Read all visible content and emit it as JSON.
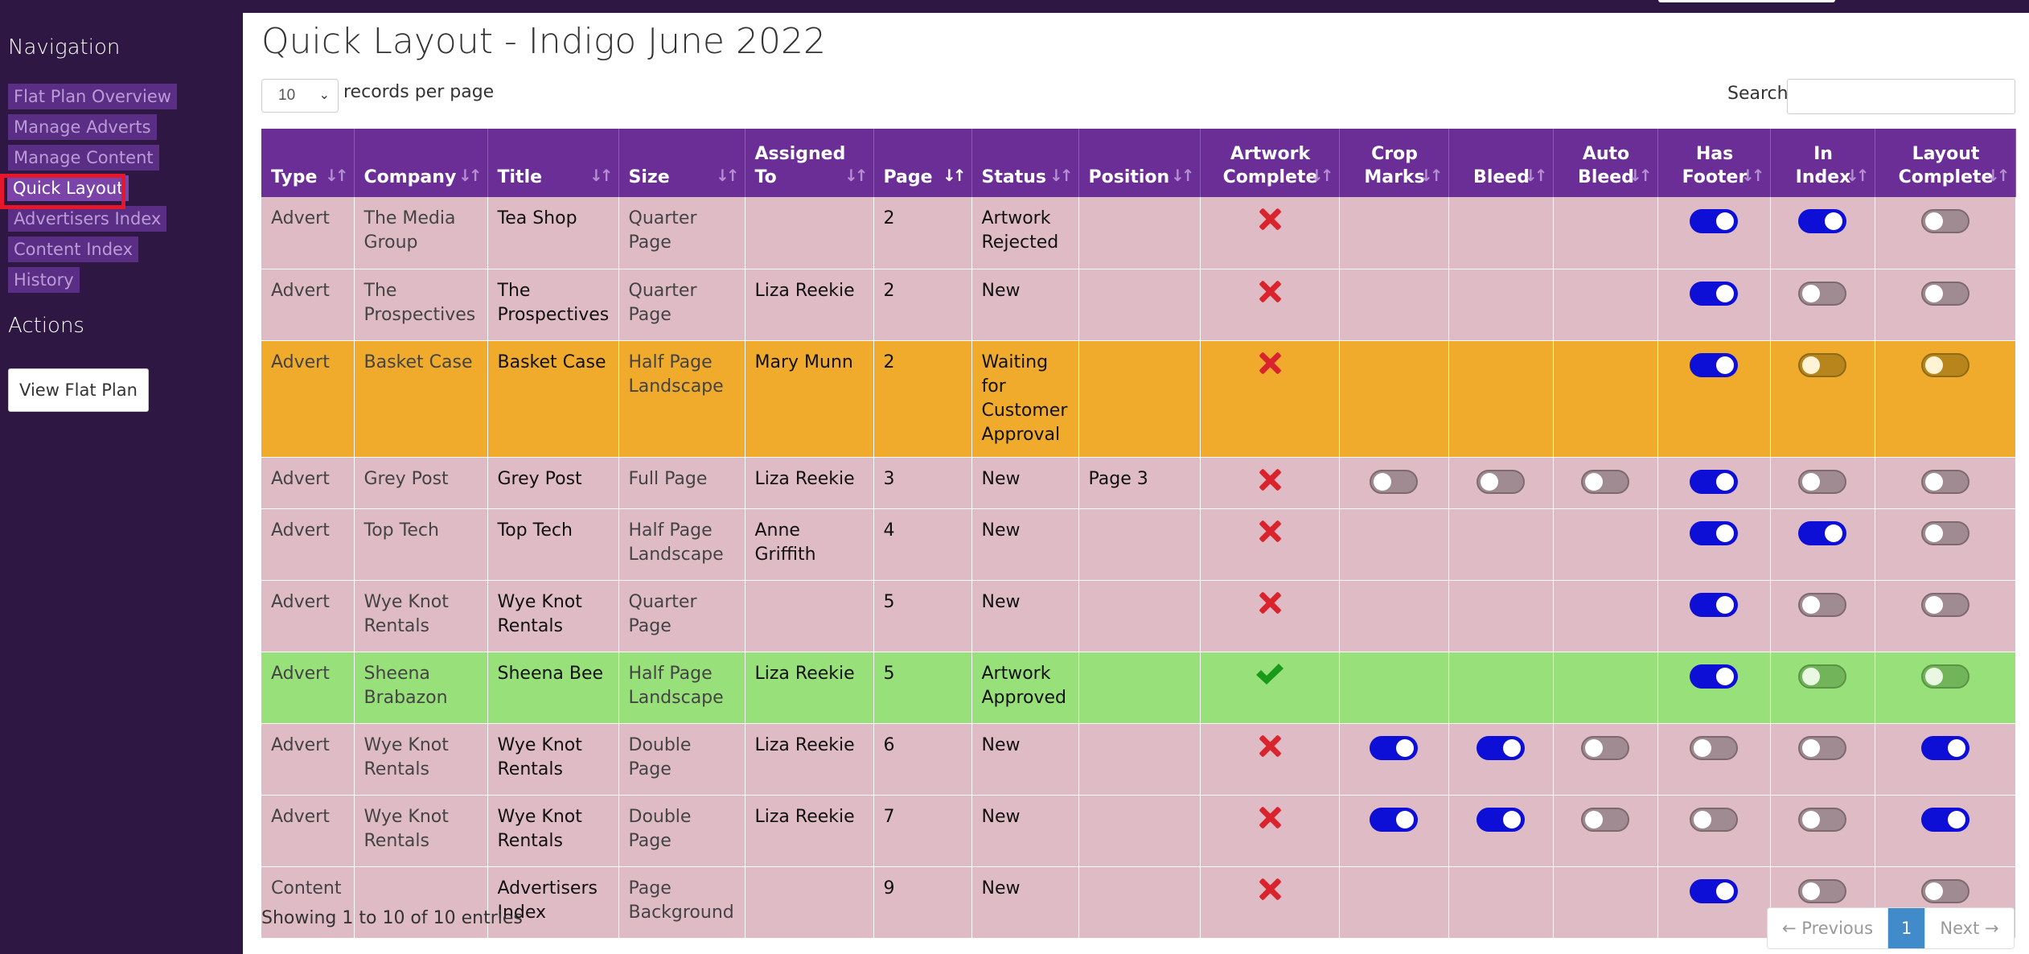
{
  "nav": {
    "heading": "Navigation",
    "items": [
      {
        "label": "Flat Plan Overview",
        "active": false
      },
      {
        "label": "Manage Adverts",
        "active": false
      },
      {
        "label": "Manage Content",
        "active": false
      },
      {
        "label": "Quick Layout",
        "active": true
      },
      {
        "label": "Advertisers Index",
        "active": false
      },
      {
        "label": "Content Index",
        "active": false
      },
      {
        "label": "History",
        "active": false
      }
    ]
  },
  "actions": {
    "heading": "Actions",
    "view_flat_plan": "View Flat Plan"
  },
  "page": {
    "title": "Quick Layout - Indigo June 2022",
    "records_value": "10",
    "records_label": "records per page",
    "search_label": "Search:",
    "search_value": ""
  },
  "table": {
    "columns": [
      {
        "l1": "",
        "l2": "Type"
      },
      {
        "l1": "",
        "l2": "Company"
      },
      {
        "l1": "",
        "l2": "Title"
      },
      {
        "l1": "",
        "l2": "Size"
      },
      {
        "l1": "Assigned",
        "l2": "To"
      },
      {
        "l1": "",
        "l2": "Page"
      },
      {
        "l1": "",
        "l2": "Status"
      },
      {
        "l1": "",
        "l2": "Position"
      },
      {
        "l1": "Artwork",
        "l2": "Complete"
      },
      {
        "l1": "Crop",
        "l2": "Marks"
      },
      {
        "l1": "",
        "l2": "Bleed"
      },
      {
        "l1": "Auto",
        "l2": "Bleed"
      },
      {
        "l1": "Has",
        "l2": "Footer"
      },
      {
        "l1": "In",
        "l2": "Index"
      },
      {
        "l1": "Layout",
        "l2": "Complete"
      }
    ],
    "rows": [
      {
        "color": "pink",
        "type": "Advert",
        "company": "The Media Group",
        "title": "Tea Shop",
        "size": "Quarter Page",
        "assigned": "",
        "page": "2",
        "status": "Artwork Rejected",
        "position": "",
        "artwork": "x",
        "crop": null,
        "bleed": null,
        "auto_bleed": null,
        "footer": true,
        "index": true,
        "layout": false
      },
      {
        "color": "pink",
        "type": "Advert",
        "company": "The Prospectives",
        "title": "The Prospectives",
        "size": "Quarter Page",
        "assigned": "Liza Reekie",
        "page": "2",
        "status": "New",
        "position": "",
        "artwork": "x",
        "crop": null,
        "bleed": null,
        "auto_bleed": null,
        "footer": true,
        "index": false,
        "layout": false
      },
      {
        "color": "orange",
        "type": "Advert",
        "company": "Basket Case",
        "title": "Basket Case",
        "size": "Half Page Landscape",
        "assigned": "Mary Munn",
        "page": "2",
        "status": "Waiting for Customer Approval",
        "position": "",
        "artwork": "x",
        "crop": null,
        "bleed": null,
        "auto_bleed": null,
        "footer": true,
        "index": false,
        "layout": false
      },
      {
        "color": "pink",
        "type": "Advert",
        "company": "Grey Post",
        "title": "Grey Post",
        "size": "Full Page",
        "assigned": "Liza Reekie",
        "page": "3",
        "status": "New",
        "position": "Page 3",
        "artwork": "x",
        "crop": false,
        "bleed": false,
        "auto_bleed": false,
        "footer": true,
        "index": false,
        "layout": false
      },
      {
        "color": "pink",
        "type": "Advert",
        "company": "Top Tech",
        "title": "Top Tech",
        "size": "Half Page Landscape",
        "assigned": "Anne Griffith",
        "page": "4",
        "status": "New",
        "position": "",
        "artwork": "x",
        "crop": null,
        "bleed": null,
        "auto_bleed": null,
        "footer": true,
        "index": true,
        "layout": false
      },
      {
        "color": "pink",
        "type": "Advert",
        "company": "Wye Knot Rentals",
        "title": "Wye Knot Rentals",
        "size": "Quarter Page",
        "assigned": "",
        "page": "5",
        "status": "New",
        "position": "",
        "artwork": "x",
        "crop": null,
        "bleed": null,
        "auto_bleed": null,
        "footer": true,
        "index": false,
        "layout": false
      },
      {
        "color": "green",
        "type": "Advert",
        "company": "Sheena Brabazon",
        "title": "Sheena Bee",
        "size": "Half Page Landscape",
        "assigned": "Liza Reekie",
        "page": "5",
        "status": "Artwork Approved",
        "position": "",
        "artwork": "check",
        "crop": null,
        "bleed": null,
        "auto_bleed": null,
        "footer": true,
        "index": false,
        "layout": false
      },
      {
        "color": "pink",
        "type": "Advert",
        "company": "Wye Knot Rentals",
        "title": "Wye Knot Rentals",
        "size": "Double Page",
        "assigned": "Liza Reekie",
        "page": "6",
        "status": "New",
        "position": "",
        "artwork": "x",
        "crop": true,
        "bleed": true,
        "auto_bleed": false,
        "footer": false,
        "index": false,
        "layout": true
      },
      {
        "color": "pink",
        "type": "Advert",
        "company": "Wye Knot Rentals",
        "title": "Wye Knot Rentals",
        "size": "Double Page",
        "assigned": "Liza Reekie",
        "page": "7",
        "status": "New",
        "position": "",
        "artwork": "x",
        "crop": true,
        "bleed": true,
        "auto_bleed": false,
        "footer": false,
        "index": false,
        "layout": true
      },
      {
        "color": "pink",
        "type": "Content",
        "company": "",
        "title": "Advertisers Index",
        "size": "Page Background",
        "assigned": "",
        "page": "9",
        "status": "New",
        "position": "",
        "artwork": "x",
        "crop": null,
        "bleed": null,
        "auto_bleed": null,
        "footer": true,
        "index": false,
        "layout": false
      }
    ]
  },
  "footer": {
    "info": "Showing 1 to 10 of 10 entries",
    "prev": "← Previous",
    "current": "1",
    "next": "Next →"
  }
}
